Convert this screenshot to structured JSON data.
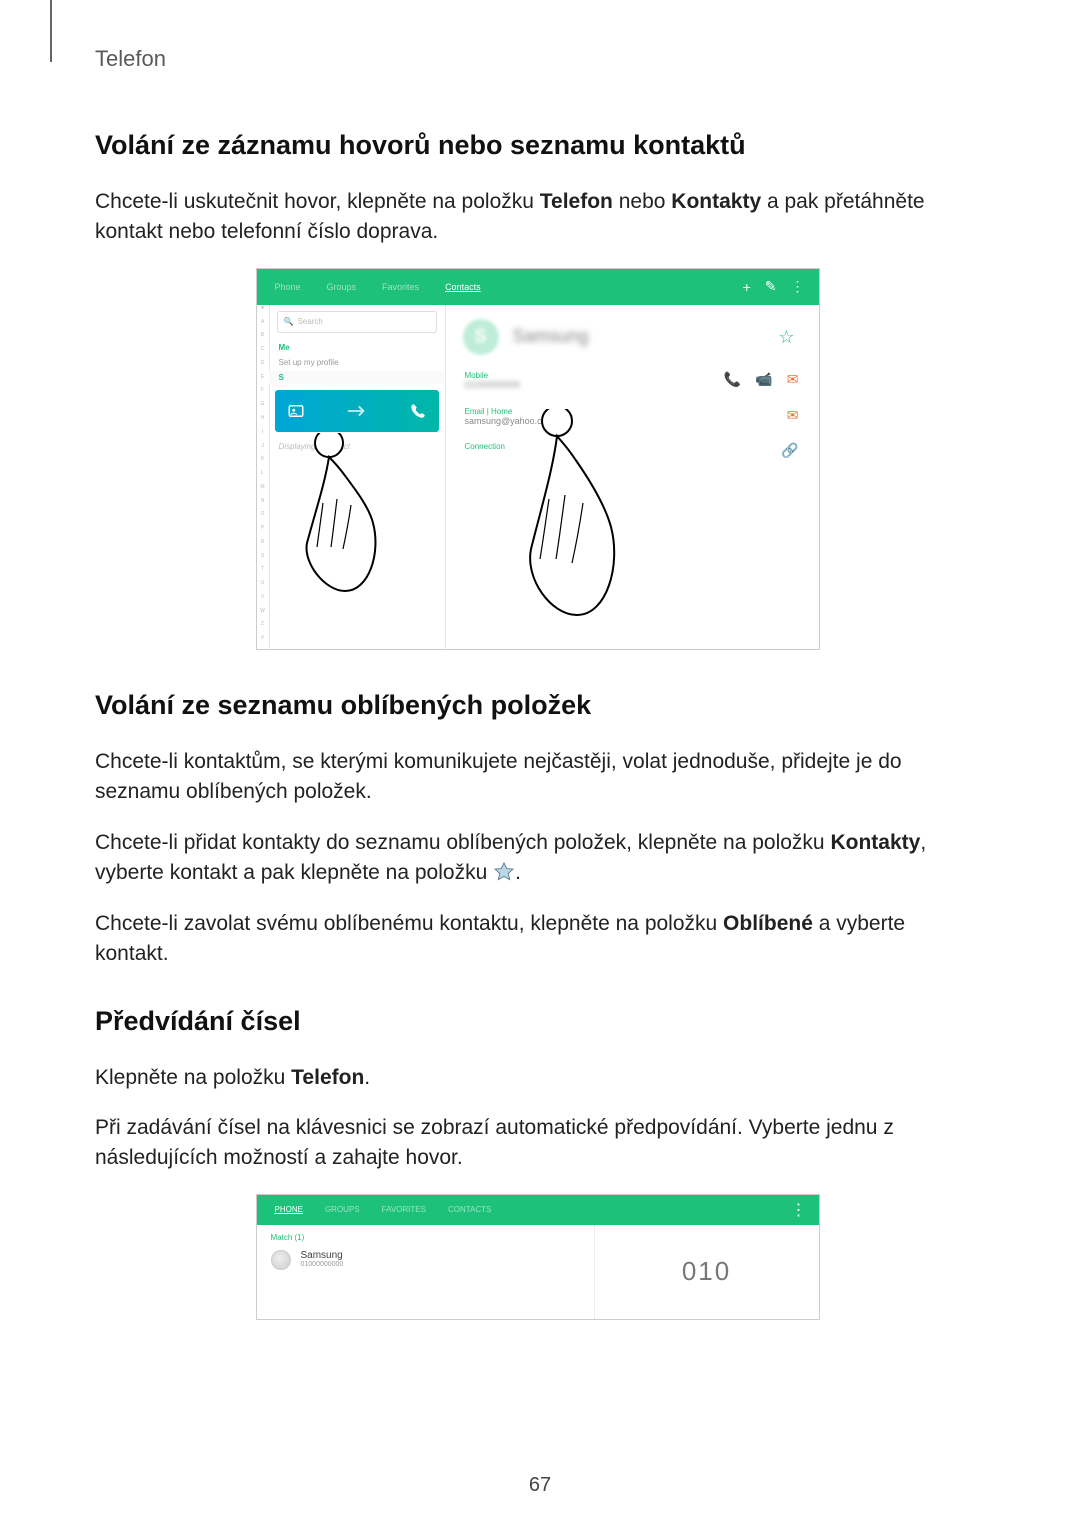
{
  "section_header": "Telefon",
  "page_number": "67",
  "h1": "Volání ze záznamu hovorů nebo seznamu kontaktů",
  "p1_pre": "Chcete-li uskutečnit hovor, klepněte na položku ",
  "p1_b1": "Telefon",
  "p1_mid": " nebo ",
  "p1_b2": "Kontakty",
  "p1_post": " a pak přetáhněte kontakt nebo telefonní číslo doprava.",
  "h2": "Volání ze seznamu oblíbených položek",
  "p2": "Chcete-li kontaktům, se kterými komunikujete nejčastěji, volat jednoduše, přidejte je do seznamu oblíbených položek.",
  "p3_pre": "Chcete-li přidat kontakty do seznamu oblíbených položek, klepněte na položku ",
  "p3_b": "Kontakty",
  "p3_post1": ", vyberte kontakt a pak klepněte na položku ",
  "p3_post2": ".",
  "p4_pre": "Chcete-li zavolat svému oblíbenému kontaktu, klepněte na položku ",
  "p4_b": "Oblíbené",
  "p4_post": " a vyberte kontakt.",
  "h3": "Předvídání čísel",
  "p5_pre": "Klepněte na položku ",
  "p5_b": "Telefon",
  "p5_post": ".",
  "p6": "Při zadávání čísel na klávesnici se zobrazí automatické předpovídání. Vyberte jednu z následujících možností a zahajte hovor.",
  "fig1": {
    "tabs": [
      "Phone",
      "Groups",
      "Favorites",
      "Contacts"
    ],
    "search_placeholder": "Search",
    "me_label": "Me",
    "setup_label": "Set up my profile",
    "letter": "S",
    "displaying": "Displaying 1 contact",
    "contact_name": "Samsung",
    "section_mobile": "Mobile",
    "section_email": "Email | Home",
    "email_value": "samsung@yahoo.com",
    "section_connection": "Connection"
  },
  "fig2": {
    "tabs": [
      "PHONE",
      "GROUPS",
      "FAVORITES",
      "CONTACTS"
    ],
    "match_label": "Match (1)",
    "contact_name": "Samsung",
    "contact_num": "01000000000",
    "dial_display": "010"
  }
}
